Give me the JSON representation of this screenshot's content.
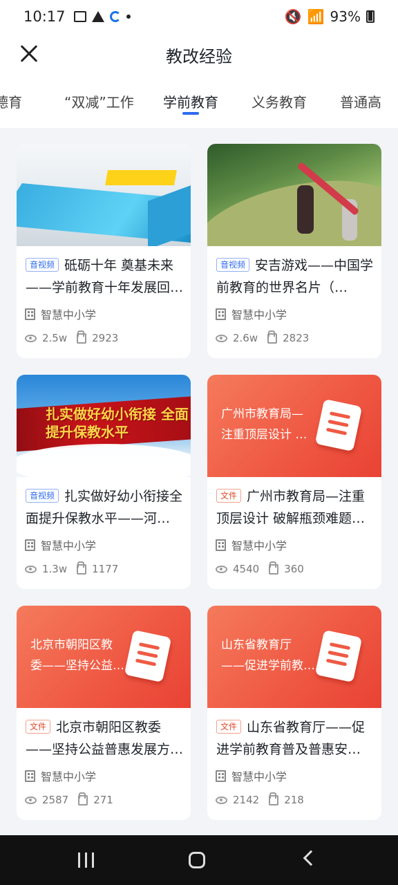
{
  "status": {
    "time": "10:17",
    "battery": "93%"
  },
  "header": {
    "title": "教改经验"
  },
  "tabs": [
    {
      "label": "德育",
      "active": false
    },
    {
      "label": "“双减”工作",
      "active": false
    },
    {
      "label": "学前教育",
      "active": true
    },
    {
      "label": "义务教育",
      "active": false
    },
    {
      "label": "普通高",
      "active": false
    }
  ],
  "cards": [
    {
      "badge": "音视频",
      "title": "砥砺十年 奠基未来——学前教育十年发展回…",
      "source": "智慧中小学",
      "views": "2.5w",
      "likes": "2923",
      "thumb_text": ""
    },
    {
      "badge": "音视频",
      "title": "安吉游戏——中国学前教育的世界名片（…",
      "source": "智慧中小学",
      "views": "2.6w",
      "likes": "2823",
      "thumb_text": ""
    },
    {
      "badge": "音视频",
      "title": "扎实做好幼小衔接全面提升保教水平——河…",
      "source": "智慧中小学",
      "views": "1.3w",
      "likes": "1177",
      "thumb_text": "扎实做好幼小衔接 全面提升保教水平"
    },
    {
      "badge": "文件",
      "title": "广州市教育局—注重顶层设计 破解瓶颈难题…",
      "source": "智慧中小学",
      "views": "4540",
      "likes": "360",
      "thumb_text": "广州市教育局— 注重顶层设计 …"
    },
    {
      "badge": "文件",
      "title": "北京市朝阳区教委——坚持公益普惠发展方…",
      "source": "智慧中小学",
      "views": "2587",
      "likes": "271",
      "thumb_text": "北京市朝阳区教 委——坚持公益…"
    },
    {
      "badge": "文件",
      "title": "山东省教育厅——促进学前教育普及普惠安…",
      "source": "智慧中小学",
      "views": "2142",
      "likes": "218",
      "thumb_text": "山东省教育厅 ——促进学前教…"
    }
  ],
  "colors": {
    "accent": "#2d6bf1",
    "doc_badge": "#e24a2b",
    "background": "#f2f4f7"
  }
}
